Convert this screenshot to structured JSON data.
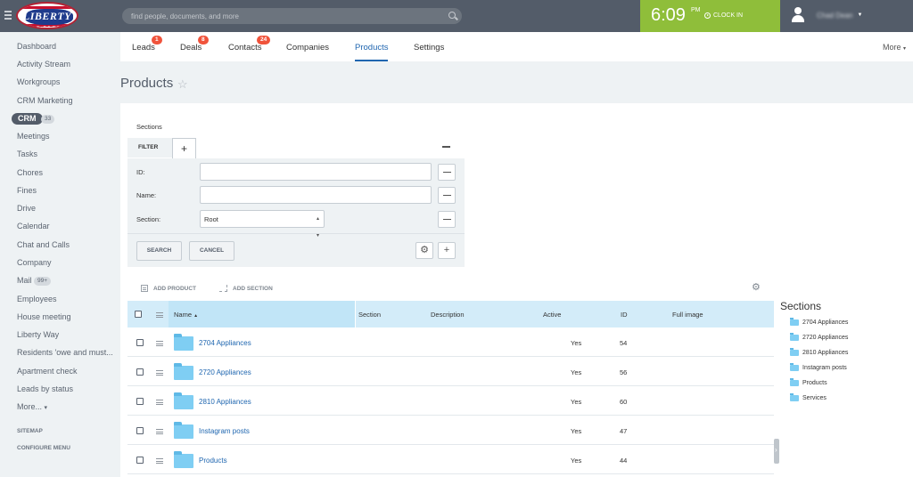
{
  "header": {
    "logo_text": "LIBERTY WAY",
    "search_placeholder": "find people, documents, and more",
    "clock_time": "6:09",
    "clock_ampm": "PM",
    "clock_in_label": "CLOCK IN",
    "user_name": "Chad Dean"
  },
  "left_menu": {
    "items": [
      "Dashboard",
      "Activity Stream",
      "Workgroups",
      "CRM Marketing"
    ],
    "crm_label": "CRM",
    "crm_count": "33",
    "items2": [
      "Meetings",
      "Tasks",
      "Chores",
      "Fines",
      "Drive",
      "Calendar",
      "Chat and Calls",
      "Company"
    ],
    "mail_label": "Mail",
    "mail_count": "99+",
    "items3": [
      "Employees",
      "House meeting",
      "Liberty Way",
      "Residents 'owe and must...",
      "Apartment check",
      "Leads by status"
    ],
    "more_label": "More...",
    "sitemap": "SITEMAP",
    "configure": "CONFIGURE MENU"
  },
  "tabs": [
    {
      "label": "Leads",
      "badge": "1"
    },
    {
      "label": "Deals",
      "badge": "8"
    },
    {
      "label": "Contacts",
      "badge": "24"
    },
    {
      "label": "Companies"
    },
    {
      "label": "Products"
    },
    {
      "label": "Settings"
    }
  ],
  "more_tab": "More",
  "page_title": "Products",
  "filter": {
    "sections_label": "Sections",
    "filter_tab": "FILTER",
    "plus": "+",
    "id_label": "ID:",
    "name_label": "Name:",
    "section_label": "Section:",
    "section_value": "Root",
    "search_btn": "SEARCH",
    "cancel_btn": "CANCEL",
    "add_plus": "+"
  },
  "actions": {
    "add_product": "ADD PRODUCT",
    "add_section": "ADD SECTION"
  },
  "grid": {
    "columns": [
      "Name",
      "Section",
      "Description",
      "Active",
      "ID",
      "Full image"
    ],
    "sort_arrow": "▲",
    "rows": [
      {
        "name": "2704 Appliances",
        "active": "Yes",
        "id": "54"
      },
      {
        "name": "2720 Appliances",
        "active": "Yes",
        "id": "56"
      },
      {
        "name": "2810 Appliances",
        "active": "Yes",
        "id": "60"
      },
      {
        "name": "Instagram posts",
        "active": "Yes",
        "id": "47"
      },
      {
        "name": "Products",
        "active": "Yes",
        "id": "44"
      }
    ]
  },
  "right_sections": {
    "title": "Sections",
    "items": [
      "2704 Appliances",
      "2720 Appliances",
      "2810 Appliances",
      "Instagram posts",
      "Products",
      "Services"
    ]
  }
}
